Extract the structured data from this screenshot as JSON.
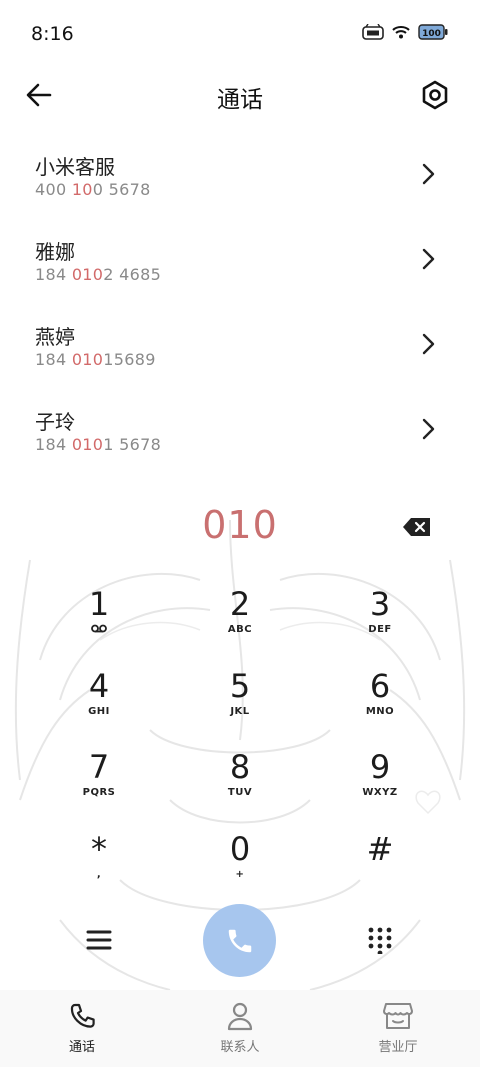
{
  "status_bar": {
    "time": "8:16",
    "battery_level": "100"
  },
  "header": {
    "title": "通话"
  },
  "contacts": [
    {
      "name": "小米客服",
      "number_parts": [
        "400 ",
        "10",
        "0 5678"
      ]
    },
    {
      "name": "雅娜",
      "number_parts": [
        "184 ",
        "010",
        "2 4685"
      ]
    },
    {
      "name": "燕婷",
      "number_parts": [
        "184 ",
        "010",
        "15689"
      ]
    },
    {
      "name": "子玲",
      "number_parts": [
        "184 ",
        "010",
        "1 5678"
      ]
    }
  ],
  "dialer": {
    "entered_number": "010"
  },
  "keypad": [
    {
      "digit": "1",
      "letters": ""
    },
    {
      "digit": "2",
      "letters": "ABC"
    },
    {
      "digit": "3",
      "letters": "DEF"
    },
    {
      "digit": "4",
      "letters": "GHI"
    },
    {
      "digit": "5",
      "letters": "JKL"
    },
    {
      "digit": "6",
      "letters": "MNO"
    },
    {
      "digit": "7",
      "letters": "PQRS"
    },
    {
      "digit": "8",
      "letters": "TUV"
    },
    {
      "digit": "9",
      "letters": "WXYZ"
    },
    {
      "digit": "*",
      "letters": ","
    },
    {
      "digit": "0",
      "letters": "+"
    },
    {
      "digit": "#",
      "letters": ""
    }
  ],
  "bottom_nav": [
    {
      "label": "通话",
      "icon": "phone-icon",
      "active": true
    },
    {
      "label": "联系人",
      "icon": "person-icon",
      "active": false
    },
    {
      "label": "营业厅",
      "icon": "store-icon",
      "active": false
    }
  ],
  "colors": {
    "highlight": "#d26a6a",
    "dial_text": "#c97070",
    "call_button": "#a7c6ee"
  }
}
